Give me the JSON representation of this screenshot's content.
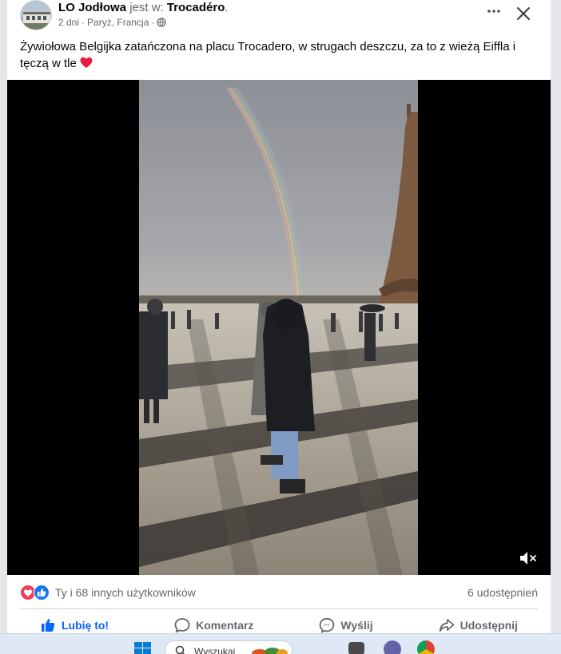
{
  "post": {
    "author": "LO Jodłowa",
    "is_at": "jest w:",
    "place": "Trocadéro",
    "period": ".",
    "time": "2 dni",
    "separator": "·",
    "location": "Paryż, Francja",
    "separator2": "·",
    "caption": "Żywiołowa Belgijka zatańczona na placu Trocadero, w strugach deszczu, za to z wieżą Eiffla i tęczą w tle",
    "caption_emoji": "❤️"
  },
  "icons": {
    "more": "more-options-icon",
    "close": "close-icon",
    "privacy": "globe-icon",
    "mute": "muted-speaker-icon",
    "like": "thumbs-up-icon",
    "comment": "speech-bubble-icon",
    "send": "messenger-icon",
    "share": "share-arrow-icon"
  },
  "reactions": {
    "summary": "Ty i 68 innych użytkowników",
    "shares": "6 udostępnień"
  },
  "actions": {
    "like": "Lubię to!",
    "comment": "Komentarz",
    "send": "Wyślij",
    "share": "Udostępnij"
  },
  "taskbar": {
    "search_placeholder": "Wyszukaj"
  },
  "colors": {
    "accent": "#0866ff",
    "love": "#f33e58",
    "muted_text": "#65676b"
  }
}
